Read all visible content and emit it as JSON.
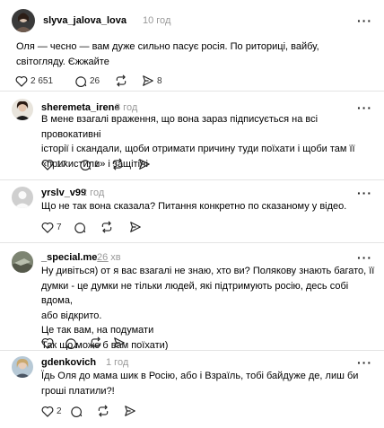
{
  "posts": [
    {
      "username": "slyva_jalova_lova",
      "time": "10 год",
      "text_lines": [
        "Оля — чесно — вам дуже сильно пасує росія. По риториці, вайбу,",
        "світогляду. Єжжайте"
      ],
      "likes": "2 651",
      "comments": "26",
      "reposts": "",
      "shares": "8"
    },
    {
      "username": "sheremeta_irene",
      "time": "8 год",
      "text_lines": [
        "В мене взагалі враження, що вона зараз підписується на всі провокативні",
        "історії і скандали, щоби отримати причину туди поїхати і щоби там її",
        "«прихистили» і защітілі"
      ],
      "likes": "17",
      "comments": "1",
      "reposts": "",
      "shares": ""
    },
    {
      "username": "yrslv_v99",
      "time": "2 год",
      "text_lines": [
        "Що не так вона сказала? Питання конкретно по сказаному у відео."
      ],
      "likes": "7",
      "comments": "",
      "reposts": "",
      "shares": ""
    },
    {
      "username": "_special.me__",
      "time": "26 хв",
      "text_lines": [
        "Ну дивіться) от я вас взагалі не знаю, хто ви? Полякову знають багато, її",
        "думки - це думки не тільки людей, які підтримують росію, десь собі вдома,",
        "або відкрито.",
        "Це так вам, на подумати",
        "Так що може б вам поїхати)"
      ],
      "likes": "",
      "comments": "",
      "reposts": "",
      "shares": ""
    },
    {
      "username": "gdenkovich",
      "time": "1 год",
      "text_lines": [
        "Їдь Оля до мама шик в Росію, або і Взраїль, тобі байдуже де, лиш би",
        "гроші платили?!"
      ],
      "likes": "2",
      "comments": "",
      "reposts": "",
      "shares": ""
    }
  ],
  "icons": {
    "more": "more-options-icon",
    "like": "heart-icon",
    "comment": "comment-icon",
    "repost": "repost-icon",
    "share": "share-icon"
  },
  "colors": {
    "text": "#000000",
    "muted": "#999999",
    "divider": "#e4e4e4"
  }
}
